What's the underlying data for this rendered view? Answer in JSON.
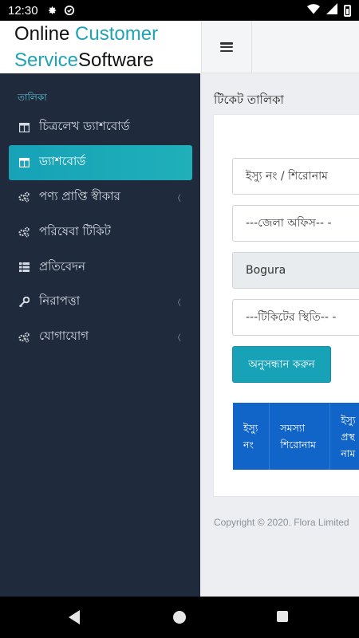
{
  "status_bar": {
    "time": "12:30"
  },
  "header": {
    "logo_part1": "Online ",
    "logo_accent": "Customer",
    "logo_part2": "Service",
    "logo_part3": "Software"
  },
  "sidebar": {
    "heading": "তালিকা",
    "items": [
      {
        "label": "চিত্রলেখ ড্যাশবোর্ড",
        "icon": "table-icon",
        "active": false,
        "has_arrow": false
      },
      {
        "label": "ড্যাশবোর্ড",
        "icon": "table-icon",
        "active": true,
        "has_arrow": false
      },
      {
        "label": "পণ্য প্রাপ্তি স্বীকার",
        "icon": "cogs-icon",
        "active": false,
        "has_arrow": true
      },
      {
        "label": "পরিষেবা টিকিট",
        "icon": "cogs-icon",
        "active": false,
        "has_arrow": false
      },
      {
        "label": "প্রতিবেদন",
        "icon": "list-icon",
        "active": false,
        "has_arrow": false
      },
      {
        "label": "নিরাপত্তা",
        "icon": "key-icon",
        "active": false,
        "has_arrow": true
      },
      {
        "label": "যোগাযোগ",
        "icon": "cogs-icon",
        "active": false,
        "has_arrow": true
      }
    ]
  },
  "main": {
    "title": "টিকেট তালিকা",
    "issue_placeholder": "ইস্যু নং / শিরোনাম",
    "district_select": "---জেলা অফিস-- -",
    "location_select": "Bogura",
    "status_select": "---টিকিটের স্থিতি-- -",
    "search_button": "অনুসন্ধান করুন",
    "table_headers": [
      [
        "ইস্যু",
        "নং"
      ],
      [
        "সমস্যা",
        "শিরোনাম"
      ],
      [
        "ইস্যু",
        "প্রস্থ",
        "নাম"
      ]
    ],
    "copyright": "Copyright © 2020. Flora Limited"
  },
  "colors": {
    "accent": "#17a2b8",
    "sidebar_bg": "#1f2a3c",
    "table_head": "#1165c9"
  }
}
